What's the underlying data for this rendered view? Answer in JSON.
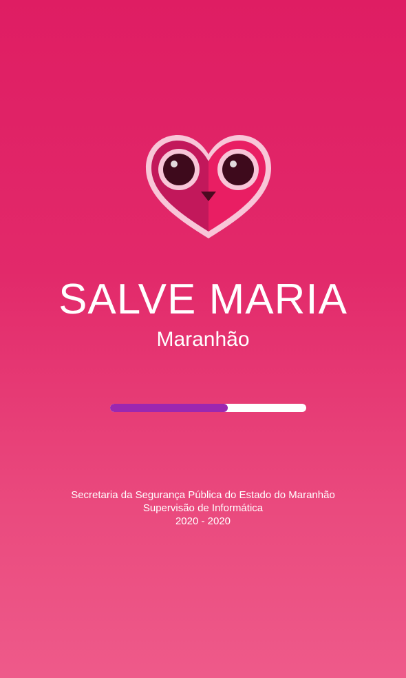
{
  "app": {
    "title": "SALVE MARIA",
    "subtitle": "Maranhão"
  },
  "logo": {
    "icon": "owl-heart-logo-icon"
  },
  "progress": {
    "fraction": 0.6,
    "fill_color": "#9c27b0",
    "track_color": "#ffffff"
  },
  "footer": {
    "line1": "Secretaria da Segurança Pública do Estado do Maranhão",
    "line2": "Supervisão de Informática",
    "line3": "2020 - 2020"
  },
  "colors": {
    "background_top": "#df1d63",
    "background_bottom": "#ee5a8a",
    "heart_outline": "#f8c6d8",
    "heart_left": "#c2185b",
    "heart_right": "#e91e63",
    "eye_dark": "#3e0a1c",
    "beak": "#4a0a20"
  }
}
